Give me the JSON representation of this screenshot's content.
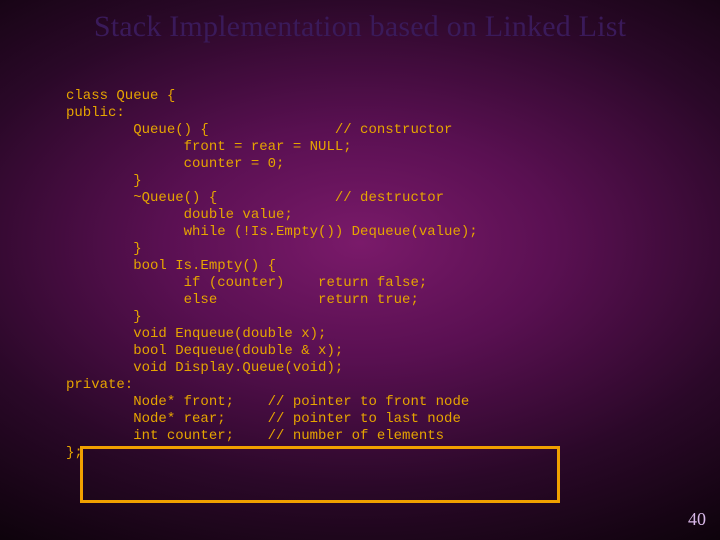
{
  "title": "Stack Implementation based on Linked List",
  "page_number": "40",
  "code": {
    "l01": "class Queue {",
    "l02": "public:",
    "l03": "        Queue() {               // constructor",
    "l04": "              front = rear = NULL;",
    "l05": "              counter = 0;",
    "l06": "        }",
    "l07": "        ~Queue() {              // destructor",
    "l08": "              double value;",
    "l09": "              while (!Is.Empty()) Dequeue(value);",
    "l10": "        }",
    "l11": "        bool Is.Empty() {",
    "l12": "              if (counter)    return false;",
    "l13": "              else            return true;",
    "l14": "        }",
    "l15": "        void Enqueue(double x);",
    "l16": "        bool Dequeue(double & x);",
    "l17": "        void Display.Queue(void);",
    "l18": "private:",
    "l19": "        Node* front;    // pointer to front node",
    "l20": "        Node* rear;     // pointer to last node",
    "l21": "        int counter;    // number of elements",
    "l22": "};"
  }
}
